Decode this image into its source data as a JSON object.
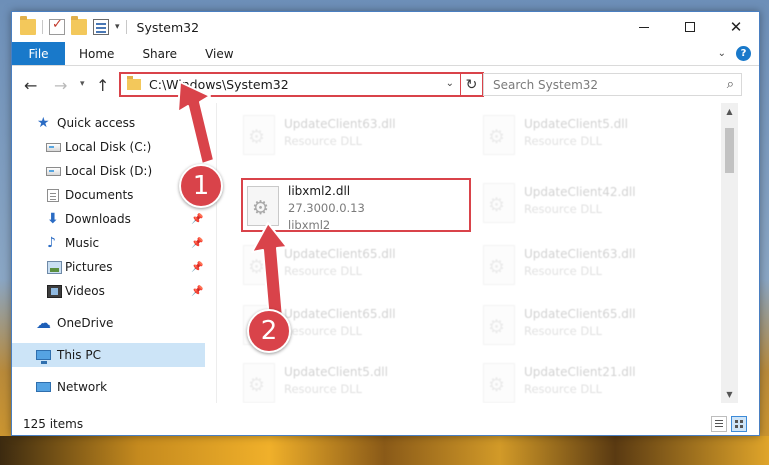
{
  "window": {
    "title": "System32"
  },
  "ribbon": {
    "tabs": [
      "File",
      "Home",
      "Share",
      "View"
    ],
    "help": "?"
  },
  "nav": {
    "back": "←",
    "forward": "→",
    "history_caret": "▾",
    "up": "↑",
    "address": "C:\\Windows\\System32",
    "search_placeholder": "Search System32"
  },
  "sidebar": {
    "items": [
      {
        "label": "Quick access",
        "icon": "star-icon"
      },
      {
        "label": "Local Disk (C:)",
        "icon": "disk-icon"
      },
      {
        "label": "Local Disk (D:)",
        "icon": "disk-icon"
      },
      {
        "label": "Documents",
        "icon": "documents-icon"
      },
      {
        "label": "Downloads",
        "icon": "downloads-icon",
        "pinned": true
      },
      {
        "label": "Music",
        "icon": "music-icon",
        "pinned": true
      },
      {
        "label": "Pictures",
        "icon": "pictures-icon",
        "pinned": true
      },
      {
        "label": "Videos",
        "icon": "videos-icon",
        "pinned": true
      },
      {
        "label": "OneDrive",
        "icon": "onedrive-icon"
      },
      {
        "label": "This PC",
        "icon": "this-pc-icon",
        "selected": true
      },
      {
        "label": "Network",
        "icon": "network-icon"
      }
    ]
  },
  "files": [
    {
      "name": "UpdateClient63.dll",
      "type": "Resource DLL"
    },
    {
      "name": "UpdateClient5.dll",
      "type": "Resource DLL"
    },
    {
      "name": "UpdateClient42.dll",
      "type": "Resource DLL"
    },
    {
      "name": "UpdateClient65.dll",
      "type": "Resource DLL"
    },
    {
      "name": "UpdateClient63.dll",
      "type": "Resource DLL"
    },
    {
      "name": "UpdateClient65.dll",
      "type": "Resource DLL"
    },
    {
      "name": "UpdateClient65.dll",
      "type": "Resource DLL"
    },
    {
      "name": "UpdateClient5.dll",
      "type": "Resource DLL"
    },
    {
      "name": "UpdateClient21.dll",
      "type": "Resource DLL"
    }
  ],
  "highlighted_file": {
    "name": "libxml2.dll",
    "version": "27.3000.0.13",
    "description": "libxml2"
  },
  "status": {
    "item_count": "125 items"
  },
  "annotations": {
    "step1": "1",
    "step2": "2",
    "color": "#d9434a"
  }
}
